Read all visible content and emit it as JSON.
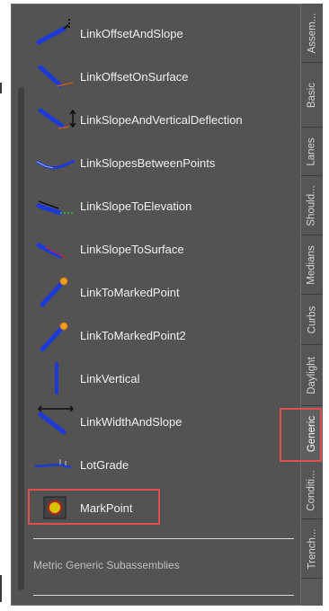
{
  "palette": {
    "panel_bg": "#535353",
    "text": "#f0f0f0",
    "highlight": "#e05050",
    "icon_blue": "#1d39d8",
    "icon_point": "#f0a020"
  },
  "items": [
    {
      "label": "LinkOffsetAndSlope",
      "icon": "link-offset-and-slope-icon"
    },
    {
      "label": "LinkOffsetOnSurface",
      "icon": "link-offset-on-surface-icon"
    },
    {
      "label": "LinkSlopeAndVerticalDeflection",
      "icon": "link-slope-vertical-deflection-icon"
    },
    {
      "label": "LinkSlopesBetweenPoints",
      "icon": "link-slopes-between-points-icon"
    },
    {
      "label": "LinkSlopeToElevation",
      "icon": "link-slope-to-elevation-icon"
    },
    {
      "label": "LinkSlopeToSurface",
      "icon": "link-slope-to-surface-icon"
    },
    {
      "label": "LinkToMarkedPoint",
      "icon": "link-to-marked-point-icon"
    },
    {
      "label": "LinkToMarkedPoint2",
      "icon": "link-to-marked-point2-icon"
    },
    {
      "label": "LinkVertical",
      "icon": "link-vertical-icon"
    },
    {
      "label": "LinkWidthAndSlope",
      "icon": "link-width-and-slope-icon"
    },
    {
      "label": "LotGrade",
      "icon": "lot-grade-icon"
    },
    {
      "label": "MarkPoint",
      "icon": "mark-point-icon",
      "highlighted": true
    }
  ],
  "section_label": "Metric Generic Subassemblies",
  "tabs": [
    {
      "label": "Assem..."
    },
    {
      "label": "Basic"
    },
    {
      "label": "Lanes"
    },
    {
      "label": "Should..."
    },
    {
      "label": "Medians"
    },
    {
      "label": "Curbs"
    },
    {
      "label": "Daylight"
    },
    {
      "label": "Generic",
      "active": true
    },
    {
      "label": "Conditi..."
    },
    {
      "label": "Trench..."
    }
  ]
}
